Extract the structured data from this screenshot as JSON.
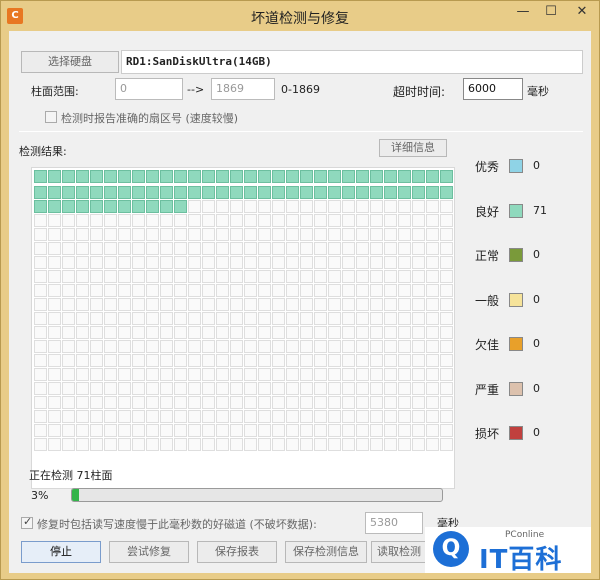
{
  "window": {
    "title": "坏道检测与修复",
    "icon_glyph": "C",
    "min_glyph": "—",
    "max_glyph": "☐",
    "close_glyph": "✕"
  },
  "disk": {
    "select_button": "选择硬盘",
    "name": "RD1:SanDiskUltra(14GB)"
  },
  "range": {
    "label": "柱面范围:",
    "start_value": "0",
    "arrow": "-->",
    "end_value": "1869",
    "total": "0-1869"
  },
  "timeout": {
    "label": "超时时间:",
    "value": "6000",
    "unit": "毫秒"
  },
  "report_option": {
    "label": "检测时报告准确的扇区号 (速度较慢)",
    "checked": false
  },
  "results": {
    "label": "检测结果:",
    "detail_button": "详细信息",
    "columns": 30,
    "rows": 20,
    "tested_cells": 71
  },
  "legend": [
    {
      "label": "优秀",
      "color": "#8fd3e6",
      "count": "0"
    },
    {
      "label": "良好",
      "color": "#8fd9bd",
      "count": "71"
    },
    {
      "label": "正常",
      "color": "#7a9a3a",
      "count": "0"
    },
    {
      "label": "一般",
      "color": "#f6e39a",
      "count": "0"
    },
    {
      "label": "欠佳",
      "color": "#e8a02a",
      "count": "0"
    },
    {
      "label": "严重",
      "color": "#dcc1ad",
      "count": "0"
    },
    {
      "label": "损坏",
      "color": "#c0403e",
      "count": "0"
    }
  ],
  "status": {
    "text": "正在检测 71柱面",
    "percent_label": "3%",
    "progress": 0.02
  },
  "repair_option": {
    "label": "修复时包括读写速度慢于此毫秒数的好磁道 (不破坏数据):",
    "checked": true,
    "value": "5380",
    "unit": "毫秒"
  },
  "buttons": {
    "stop": "停止",
    "try_repair": "尝试修复",
    "save_report": "保存报表",
    "save_info": "保存检测信息",
    "read_info": "读取检测"
  },
  "watermark": {
    "circle_glyph": "Q",
    "brand_small": "PConline",
    "brand_big": "IT百科"
  }
}
